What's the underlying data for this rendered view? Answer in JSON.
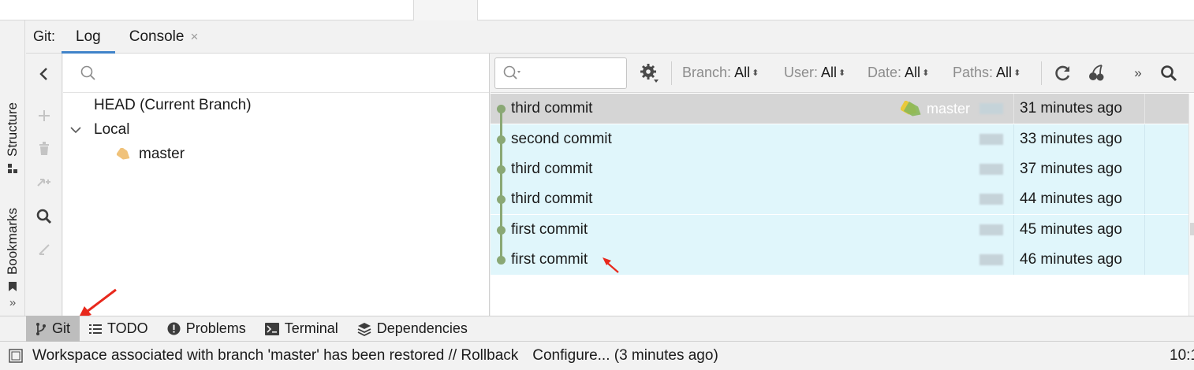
{
  "side_tabs": {
    "structure_label": "Structure",
    "bookmarks_label": "Bookmarks",
    "more_label": "»"
  },
  "tool_window": {
    "title": "Git:",
    "tabs": [
      {
        "label": "Log"
      },
      {
        "label": "Console"
      }
    ],
    "close_glyph": "×"
  },
  "branches_panel": {
    "search_placeholder": "",
    "head_label": "HEAD (Current Branch)",
    "local_label": "Local",
    "branch_label": "master"
  },
  "log_toolbar": {
    "search_value": "",
    "filters": [
      {
        "label": "Branch:",
        "value": "All"
      },
      {
        "label": "User:",
        "value": "All"
      },
      {
        "label": "Date:",
        "value": "All"
      },
      {
        "label": "Paths:",
        "value": "All"
      }
    ],
    "arrow_glyph": "⬍",
    "more_glyph": "»"
  },
  "commits": [
    {
      "message": "third commit",
      "date": "31 minutes ago",
      "tag": "master",
      "selected": true
    },
    {
      "message": "second commit",
      "date": "33 minutes ago"
    },
    {
      "message": "third commit",
      "date": "37 minutes ago"
    },
    {
      "message": "third commit",
      "date": "44 minutes ago"
    },
    {
      "message": "first commit",
      "date": "45 minutes ago"
    },
    {
      "message": "first commit",
      "date": "46 minutes ago"
    }
  ],
  "bottom_tabs": [
    {
      "label": "Git",
      "icon": "git-branch-icon",
      "active": true
    },
    {
      "label": "TODO",
      "icon": "list-icon"
    },
    {
      "label": "Problems",
      "icon": "problems-icon"
    },
    {
      "label": "Terminal",
      "icon": "terminal-icon"
    },
    {
      "label": "Dependencies",
      "icon": "dependencies-icon"
    }
  ],
  "status_bar": {
    "message": "Workspace associated with branch 'master' has been restored // Rollback",
    "configure": "Configure... (3 minutes ago)",
    "position": "10:1"
  },
  "colors": {
    "accent": "#4083c9",
    "row_highlight": "#e0f6fb",
    "row_selected": "#d5d5d5",
    "graph": "#8aa875",
    "tag": "#e9c46a",
    "annotation": "#e8281c"
  }
}
